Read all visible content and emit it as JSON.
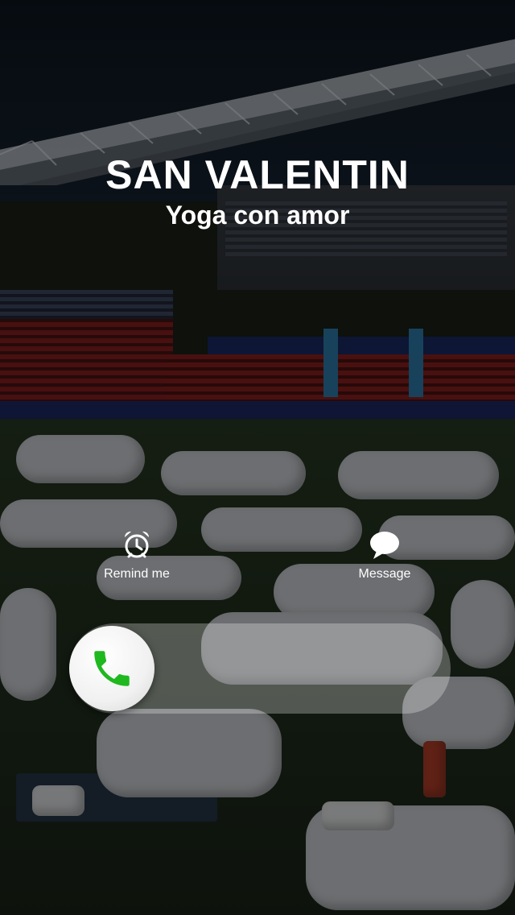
{
  "incoming_call": {
    "caller_name": "SAN VALENTIN",
    "caller_subtitle": "Yoga con amor"
  },
  "actions": {
    "remind": {
      "label": "Remind me",
      "icon": "alarm-clock-icon"
    },
    "message": {
      "label": "Message",
      "icon": "speech-bubble-icon"
    }
  },
  "answer_slider": {
    "icon": "phone-handset-icon",
    "icon_color": "#1fb81f"
  },
  "colors": {
    "text": "#ffffff",
    "accept_green": "#1fb81f"
  }
}
